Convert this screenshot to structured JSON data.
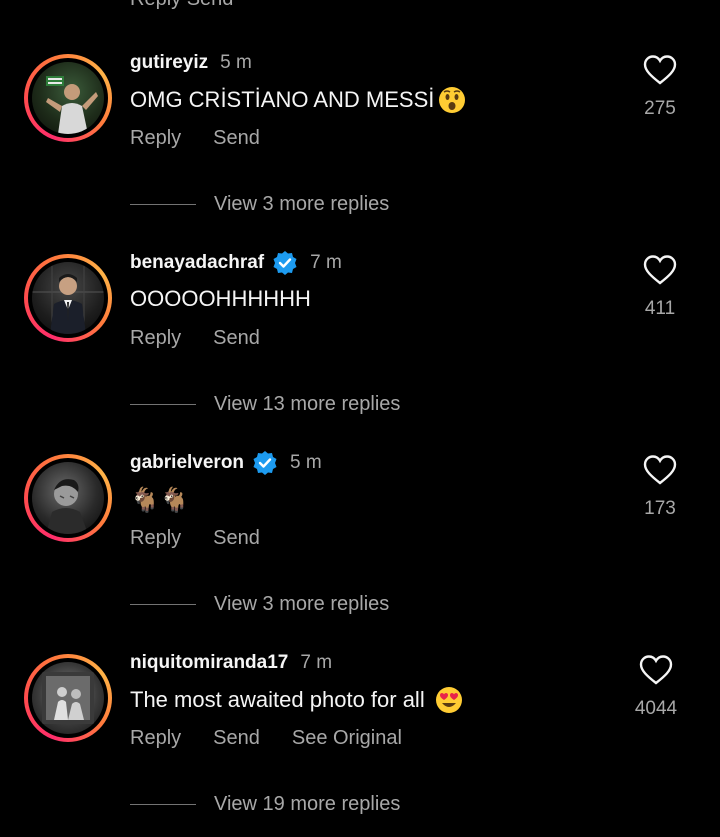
{
  "top_cutoff_text": "Reply   Send",
  "comments": [
    {
      "username": "gutireyiz",
      "time": "5 m",
      "verified": false,
      "text": "OMG CRİSTİANO AND MESSİ",
      "emoji": "astonished-face-icon",
      "likes": "275",
      "actions": [
        "Reply",
        "Send"
      ],
      "view_replies": "View 3 more replies"
    },
    {
      "username": "benayadachraf",
      "time": "7 m",
      "verified": true,
      "text": "OOOOOHHHHHH",
      "emoji": "",
      "likes": "411",
      "actions": [
        "Reply",
        "Send"
      ],
      "view_replies": "View 13 more replies"
    },
    {
      "username": "gabrielveron",
      "time": "5 m",
      "verified": true,
      "text": "🐐🐐",
      "emoji": "goat-icon",
      "likes": "173",
      "actions": [
        "Reply",
        "Send"
      ],
      "view_replies": "View 3 more replies"
    },
    {
      "username": "niquitomiranda17",
      "time": "7 m",
      "verified": false,
      "text": "The most awaited photo for all",
      "emoji": "heart-eyes-face-icon",
      "likes": "4044",
      "actions": [
        "Reply",
        "Send",
        "See Original"
      ],
      "view_replies": "View 19 more replies"
    }
  ],
  "colors": {
    "background": "#000000",
    "primary_text": "#f5f5f5",
    "secondary_text": "#a8a8a8",
    "verified_blue": "#1d9bf0",
    "story_ring": "#ff4d6d"
  }
}
